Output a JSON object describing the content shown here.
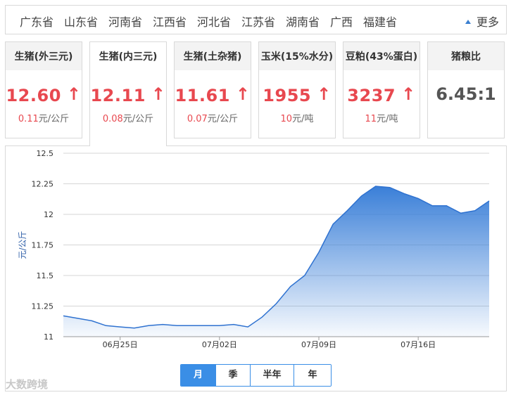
{
  "provinces": [
    "广东省",
    "山东省",
    "河南省",
    "江西省",
    "河北省",
    "江苏省",
    "湖南省",
    "广西",
    "福建省"
  ],
  "more_label": "更多",
  "cards": [
    {
      "title": "生猪(外三元)",
      "price": "12.60",
      "change": "0.11",
      "unit": "元/公斤"
    },
    {
      "title": "生猪(内三元)",
      "price": "12.11",
      "change": "0.08",
      "unit": "元/公斤"
    },
    {
      "title": "生猪(土杂猪)",
      "price": "11.61",
      "change": "0.07",
      "unit": "元/公斤"
    },
    {
      "title": "玉米(15%水分)",
      "price": "1955",
      "change": "10",
      "unit": "元/吨"
    },
    {
      "title": "豆粕(43%蛋白)",
      "price": "3237",
      "change": "11",
      "unit": "元/吨"
    }
  ],
  "ratio_card": {
    "title": "猪粮比",
    "value": "6.45:1"
  },
  "up_arrow": "↑",
  "periods": [
    "月",
    "季",
    "半年",
    "年"
  ],
  "active_period": "月",
  "watermark": "大数跨境",
  "chart_data": {
    "type": "area",
    "ylabel": "元/公斤",
    "ylim": [
      11,
      12.5
    ],
    "yticks": [
      "12.5",
      "12.25",
      "12",
      "11.75",
      "11.5",
      "11.25",
      "11"
    ],
    "xticks": [
      "06月25日",
      "07月02日",
      "07月09日",
      "07月16日"
    ],
    "x": [
      "06-21",
      "06-22",
      "06-23",
      "06-24",
      "06-25",
      "06-26",
      "06-27",
      "06-28",
      "06-29",
      "06-30",
      "07-01",
      "07-02",
      "07-03",
      "07-04",
      "07-05",
      "07-06",
      "07-07",
      "07-08",
      "07-09",
      "07-10",
      "07-11",
      "07-12",
      "07-13",
      "07-14",
      "07-15",
      "07-16",
      "07-17",
      "07-18",
      "07-19",
      "07-20",
      "07-21"
    ],
    "values": [
      11.17,
      11.15,
      11.13,
      11.09,
      11.08,
      11.07,
      11.09,
      11.1,
      11.09,
      11.09,
      11.09,
      11.09,
      11.1,
      11.08,
      11.16,
      11.27,
      11.41,
      11.5,
      11.69,
      11.92,
      12.03,
      12.15,
      12.23,
      12.22,
      12.17,
      12.13,
      12.07,
      12.07,
      12.01,
      12.03,
      12.11
    ],
    "grid": true,
    "fill_color": "#3a7fd8",
    "line_color": "#2f72d0"
  }
}
